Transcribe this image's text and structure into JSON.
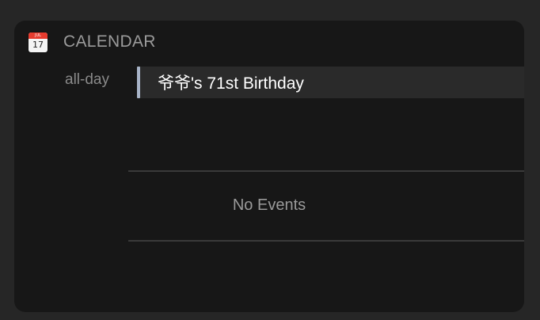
{
  "widget": {
    "title": "CALENDAR",
    "icon": {
      "name": "calendar-app-icon",
      "month": "JUL",
      "day": "17"
    },
    "all_day_label": "all-day",
    "events": [
      {
        "title": "爷爷's 71st Birthday",
        "color": "#a8b4c8"
      }
    ],
    "empty_text": "No Events"
  }
}
